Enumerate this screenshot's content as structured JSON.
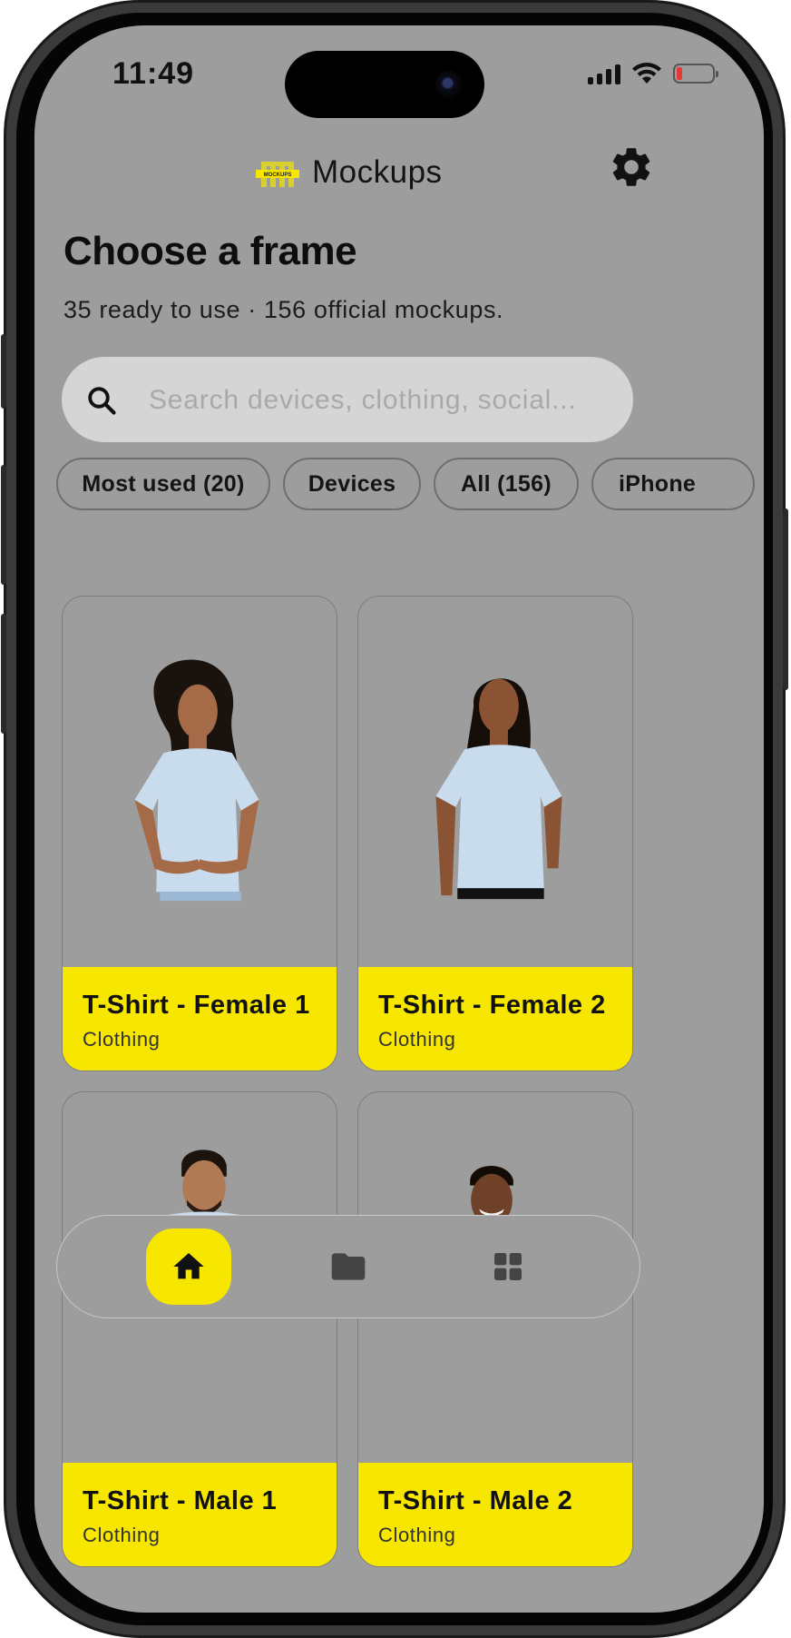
{
  "status_bar": {
    "time": "11:49"
  },
  "app": {
    "title": "Mockups",
    "logo_text": "MOCKUPS",
    "brand_color": "#f7e600"
  },
  "header": {
    "headline": "Choose a frame",
    "subline": "35 ready to use · 156 official mockups."
  },
  "search": {
    "placeholder": "Search devices, clothing, social..."
  },
  "filters": [
    {
      "label": "Most used (20)"
    },
    {
      "label": "Devices"
    },
    {
      "label": "All (156)"
    },
    {
      "label": "iPhone"
    }
  ],
  "cards": [
    {
      "title": "T-Shirt - Female 1",
      "category": "Clothing"
    },
    {
      "title": "T-Shirt - Female 2",
      "category": "Clothing"
    },
    {
      "title": "T-Shirt - Male 1",
      "category": "Clothing"
    },
    {
      "title": "T-Shirt - Male 2",
      "category": "Clothing"
    }
  ],
  "bottom_nav": [
    {
      "icon": "home-icon",
      "active": true
    },
    {
      "icon": "folder-icon",
      "active": false
    },
    {
      "icon": "grid-icon",
      "active": false
    }
  ]
}
